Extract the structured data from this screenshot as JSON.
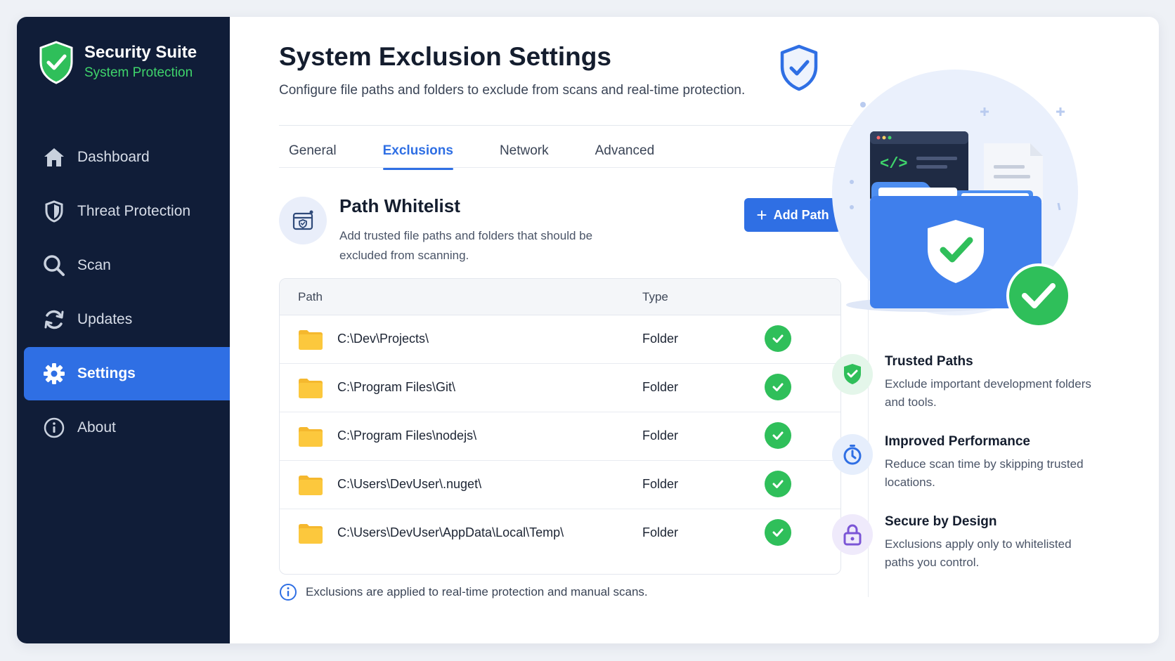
{
  "brand": {
    "title": "Security Suite",
    "subtitle": "System Protection"
  },
  "nav": [
    {
      "label": "Dashboard",
      "icon": "home-icon"
    },
    {
      "label": "Threat Protection",
      "icon": "shield-icon"
    },
    {
      "label": "Scan",
      "icon": "search-icon"
    },
    {
      "label": "Updates",
      "icon": "refresh-icon"
    },
    {
      "label": "Settings",
      "icon": "gear-icon",
      "active": true
    },
    {
      "label": "About",
      "icon": "info-icon"
    }
  ],
  "header": {
    "title": "System Exclusion Settings",
    "subtitle": "Configure file paths and folders to exclude from scans and real-time protection."
  },
  "tabs": [
    "General",
    "Exclusions",
    "Network",
    "Advanced"
  ],
  "active_tab": "Exclusions",
  "whitelist": {
    "title": "Path Whitelist",
    "description": "Add trusted file paths and folders that should be excluded from scanning.",
    "add_button": "Add Path"
  },
  "table": {
    "columns": [
      "Path",
      "Type"
    ],
    "rows": [
      {
        "path": "C:\\Dev\\Projects\\",
        "type": "Folder"
      },
      {
        "path": "C:\\Program Files\\Git\\",
        "type": "Folder"
      },
      {
        "path": "C:\\Program Files\\nodejs\\",
        "type": "Folder"
      },
      {
        "path": "C:\\Users\\DevUser\\.nuget\\",
        "type": "Folder"
      },
      {
        "path": "C:\\Users\\DevUser\\AppData\\Local\\Temp\\",
        "type": "Folder"
      }
    ]
  },
  "footer_note": "Exclusions are applied to real-time protection and manual scans.",
  "features": [
    {
      "title": "Trusted Paths",
      "description": "Exclude important development folders and tools.",
      "icon": "shield-check-icon"
    },
    {
      "title": "Improved Performance",
      "description": "Reduce scan time by skipping trusted locations.",
      "icon": "stopwatch-icon"
    },
    {
      "title": "Secure by Design",
      "description": "Exclusions apply only to whitelisted paths you control.",
      "icon": "lock-icon"
    }
  ],
  "colors": {
    "sidebar": "#101d38",
    "accent": "#2f6fe4",
    "success": "#2fbf5a",
    "brand_green": "#3fd46b"
  }
}
